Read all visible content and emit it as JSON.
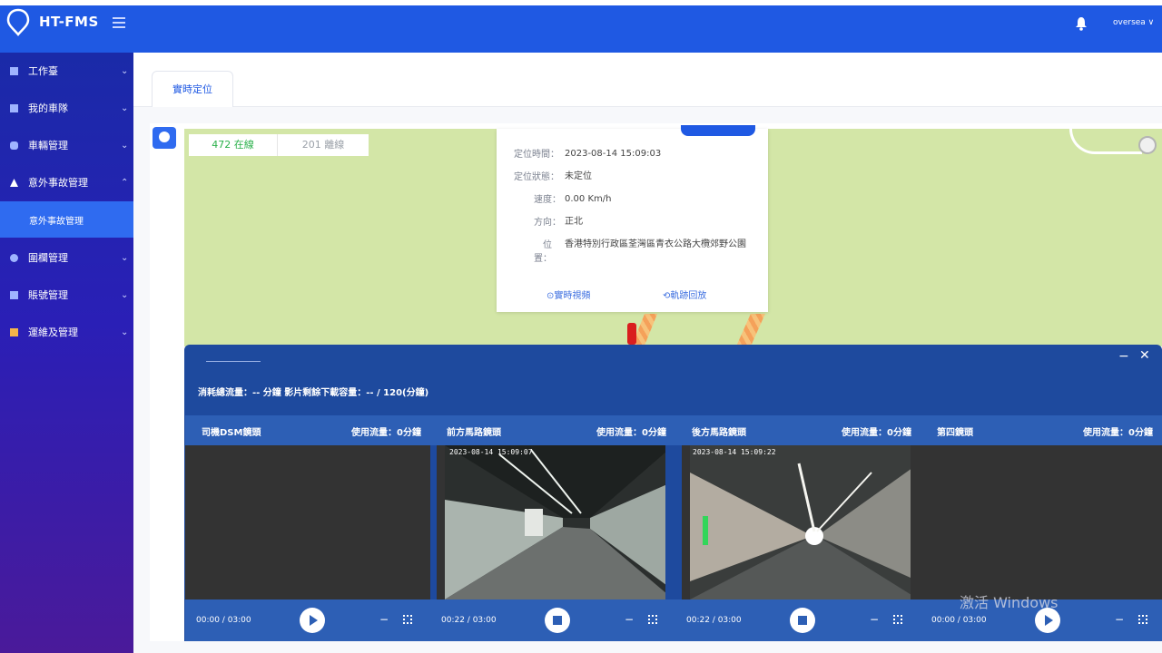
{
  "app": {
    "brand": "HT-FMS",
    "user": "oversea ∨"
  },
  "sidebar": {
    "items": [
      {
        "label": "工作臺",
        "icon": "dashboard-icon"
      },
      {
        "label": "我的車隊",
        "icon": "fleet-icon"
      },
      {
        "label": "車輛管理",
        "icon": "car-icon"
      },
      {
        "label": "意外事故管理",
        "icon": "warning-icon"
      },
      {
        "label": "圍欄管理",
        "icon": "fence-icon"
      },
      {
        "label": "賬號管理",
        "icon": "user-icon"
      },
      {
        "label": "運維及管理",
        "icon": "tools-icon"
      }
    ],
    "active_sub": "意外事故管理"
  },
  "tabs": [
    {
      "label": "實時定位"
    }
  ],
  "map": {
    "online_count": "472 在線",
    "offline_count": "201 離線"
  },
  "popup": {
    "rows": [
      {
        "label": "定位時間：",
        "value": "2023-08-14 15:09:03"
      },
      {
        "label": "定位狀態：",
        "value": "未定位"
      },
      {
        "label": "速度：",
        "value": "0.00 Km/h"
      },
      {
        "label": "方向：",
        "value": "正北"
      },
      {
        "label": "位置：",
        "value": "香港特別行政區荃灣區青衣公路大欖郊野公園"
      }
    ],
    "link_live": "⊙實時視頻",
    "link_track": "⟲軌跡回放"
  },
  "video": {
    "stats": "消耗總流量：-- 分鐘   影片剩餘下載容量：-- / 120(分鐘)",
    "columns": [
      {
        "name": "司機DSM鏡頭",
        "usage": "使用流量：0分鐘",
        "time": "00:00 / 03:00",
        "state": "paused"
      },
      {
        "name": "前方馬路鏡頭",
        "usage": "使用流量：0分鐘",
        "time": "00:22 / 03:00",
        "state": "playing"
      },
      {
        "name": "後方馬路鏡頭",
        "usage": "使用流量：0分鐘",
        "time": "00:22 / 03:00",
        "state": "playing"
      },
      {
        "name": "第四鏡頭",
        "usage": "使用流量：0分鐘",
        "time": "00:00 / 03:00",
        "state": "paused"
      }
    ],
    "overlay_front": "2023-08-14 15:09:07",
    "overlay_rear": "2023-08-14 15:09:22",
    "minimize": "−",
    "close": "✕"
  },
  "watermark": "激活 Windows",
  "colors": {
    "primary": "#1f59e3",
    "online": "#2ab04a",
    "map_bg": "#d3e6a7"
  }
}
